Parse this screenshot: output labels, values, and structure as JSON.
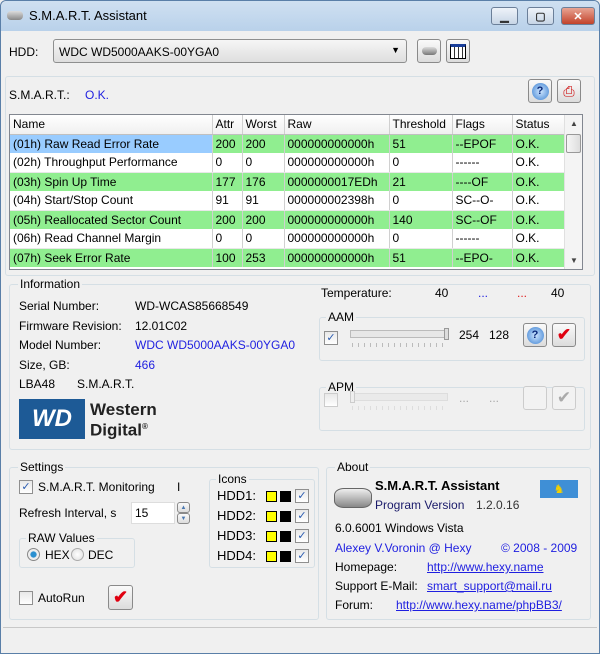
{
  "window": {
    "title": "S.M.A.R.T. Assistant",
    "minimize": "▁",
    "maximize": "▢",
    "close": "✕"
  },
  "hdd": {
    "label": "HDD:",
    "selected": "WDC WD5000AAKS-00YGA0"
  },
  "smart": {
    "label": "S.M.A.R.T.:",
    "status": "O.K."
  },
  "table": {
    "columns": [
      "Name",
      "Attr",
      "Worst",
      "Raw",
      "Threshold",
      "Flags",
      "Status"
    ],
    "rows": [
      [
        "(01h) Raw Read Error Rate",
        "200",
        "200",
        "000000000000h",
        "51",
        "--EPOF",
        "O.K."
      ],
      [
        "(02h) Throughput Performance",
        "0",
        "0",
        "000000000000h",
        "0",
        "------",
        "O.K."
      ],
      [
        "(03h) Spin Up Time",
        "177",
        "176",
        "0000000017EDh",
        "21",
        "----OF",
        "O.K."
      ],
      [
        "(04h) Start/Stop Count",
        "91",
        "91",
        "000000002398h",
        "0",
        "SC--O-",
        "O.K."
      ],
      [
        "(05h) Reallocated Sector Count",
        "200",
        "200",
        "000000000000h",
        "140",
        "SC--OF",
        "O.K."
      ],
      [
        "(06h) Read Channel Margin",
        "0",
        "0",
        "000000000000h",
        "0",
        "------",
        "O.K."
      ],
      [
        "(07h) Seek Error Rate",
        "100",
        "253",
        "000000000000h",
        "51",
        "--EPO-",
        "O.K."
      ]
    ]
  },
  "info": {
    "title": "Information",
    "serial_label": "Serial Number:",
    "serial": "WD-WCAS85668549",
    "fw_label": "Firmware Revision:",
    "fw": "12.01C02",
    "model_label": "Model Number:",
    "model": "WDC WD5000AAKS-00YGA0",
    "size_label": "Size, GB:",
    "size": "466",
    "feat1": "LBA48",
    "feat2": "S.M.A.R.T.",
    "logo": "WD Western Digital",
    "temp_label": "Temperature:",
    "temp": "40",
    "temp_min": "...",
    "temp_max": "...",
    "temp2": "40",
    "aam": {
      "title": "AAM",
      "checked": true,
      "value1": "254",
      "value2": "128",
      "level": 1.0
    },
    "apm": {
      "title": "APM",
      "checked": false,
      "value1": "...",
      "value2": "...",
      "level": 0.0
    }
  },
  "settings": {
    "title": "Settings",
    "monitoring": "S.M.A.R.T. Monitoring",
    "monitoring_extra": "I",
    "refresh_label": "Refresh Interval, s",
    "refresh": "15",
    "raw_title": "RAW Values",
    "hex": "HEX",
    "dec": "DEC",
    "autorun": "AutoRun",
    "icons_title": "Icons",
    "hdds": [
      "HDD1:",
      "HDD2:",
      "HDD3:",
      "HDD4:"
    ]
  },
  "about": {
    "title": "About",
    "app": "S.M.A.R.T. Assistant",
    "version_label": "Program Version",
    "version": "1.2.0.16",
    "os": "6.0.6001 Windows Vista",
    "author": "Alexey V.Voronin @ Hexy",
    "copyright": "© 2008 - 2009",
    "home_label": "Homepage:",
    "home": "http://www.hexy.name",
    "email_label": "Support E-Mail:",
    "email": "smart_support@mail.ru",
    "forum_label": "Forum:",
    "forum": "http://www.hexy.name/phpBB3/"
  }
}
